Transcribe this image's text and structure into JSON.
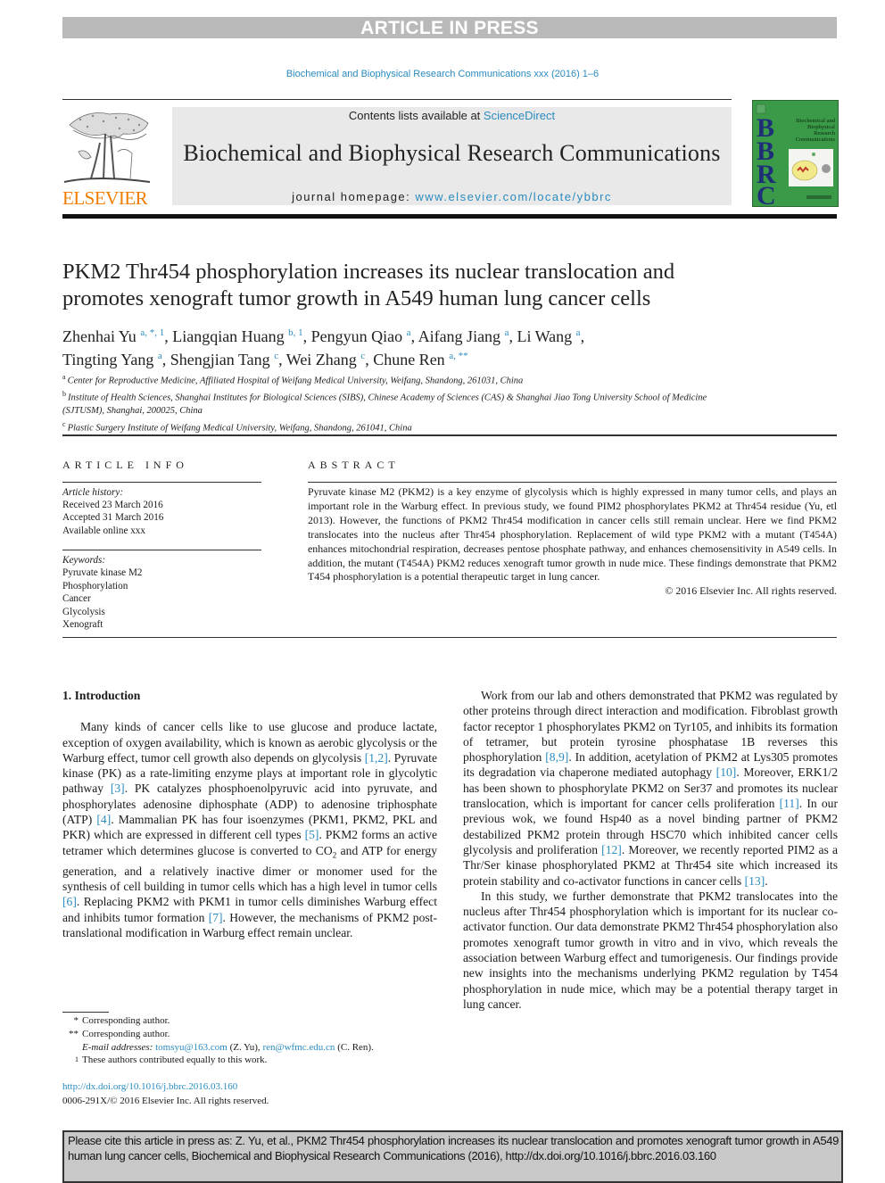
{
  "banner": "ARTICLE IN PRESS",
  "journal_ref": "Biochemical and Biophysical Research Communications xxx (2016) 1–6",
  "header": {
    "contents_prefix": "Contents lists available at ",
    "contents_link": "ScienceDirect",
    "journal_title": "Biochemical and Biophysical Research Communications",
    "homepage_prefix": "journal homepage: ",
    "homepage_link": "www.elsevier.com/locate/ybbrc",
    "publisher_logo": "ELSEVIER",
    "cover": {
      "letters": [
        "B",
        "B",
        "R",
        "C"
      ],
      "title_lines": [
        "Biochemical and",
        "Biophysical",
        "Research",
        "Communications"
      ]
    },
    "colors": {
      "link": "#2a8bbf",
      "elsevier_orange": "#f07d00",
      "cover_green": "#3a9a48",
      "cover_letters": "#1e2f78"
    }
  },
  "article": {
    "title_line1": "PKM2 Thr454 phosphorylation increases its nuclear translocation and",
    "title_line2": "promotes xenograft tumor growth in A549 human lung cancer cells",
    "authors": [
      {
        "name": "Zhenhai Yu",
        "sup": "a, *, 1",
        "sep": ", "
      },
      {
        "name": "Liangqian Huang",
        "sup": "b, 1",
        "sep": ", "
      },
      {
        "name": "Pengyun Qiao",
        "sup": "a",
        "sep": ", "
      },
      {
        "name": "Aifang Jiang",
        "sup": "a",
        "sep": ", "
      },
      {
        "name": "Li Wang",
        "sup": "a",
        "sep": ","
      },
      {
        "name": "Tingting Yang",
        "sup": "a",
        "sep": ", "
      },
      {
        "name": "Shengjian Tang",
        "sup": "c",
        "sep": ", "
      },
      {
        "name": "Wei Zhang",
        "sup": "c",
        "sep": ", "
      },
      {
        "name": "Chune Ren",
        "sup": "a, **",
        "sep": ""
      }
    ],
    "affiliations": [
      {
        "label": "a",
        "text": "Center for Reproductive Medicine, Affiliated Hospital of Weifang Medical University, Weifang, Shandong, 261031, China"
      },
      {
        "label": "b",
        "text": "Institute of Health Sciences, Shanghai Institutes for Biological Sciences (SIBS), Chinese Academy of Sciences (CAS) & Shanghai Jiao Tong University School of Medicine (SJTUSM), Shanghai, 200025, China"
      },
      {
        "label": "c",
        "text": "Plastic Surgery Institute of Weifang Medical University, Weifang, Shandong, 261041, China"
      }
    ]
  },
  "article_info": {
    "heading": "ARTICLE INFO",
    "history_label": "Article history:",
    "history": [
      "Received 23 March 2016",
      "Accepted 31 March 2016",
      "Available online xxx"
    ],
    "keywords_label": "Keywords:",
    "keywords": [
      "Pyruvate kinase M2",
      "Phosphorylation",
      "Cancer",
      "Glycolysis",
      "Xenograft"
    ]
  },
  "abstract": {
    "heading": "ABSTRACT",
    "text": "Pyruvate kinase M2 (PKM2) is a key enzyme of glycolysis which is highly expressed in many tumor cells, and plays an important role in the Warburg effect. In previous study, we found PIM2 phosphorylates PKM2 at Thr454 residue (Yu, etl 2013). However, the functions of PKM2 Thr454 modification in cancer cells still remain unclear. Here we find PKM2 translocates into the nucleus after Thr454 phosphorylation. Replacement of wild type PKM2 with a mutant (T454A) enhances mitochondrial respiration, decreases pentose phosphate pathway, and enhances chemosensitivity in A549 cells. In addition, the mutant (T454A) PKM2 reduces xenograft tumor growth in nude mice. These findings demonstrate that PKM2 T454 phosphorylation is a potential therapeutic target in lung cancer.",
    "copyright": "© 2016 Elsevier Inc. All rights reserved."
  },
  "body": {
    "section_heading": "1.  Introduction",
    "left_paragraphs": [
      [
        {
          "t": "Many kinds of cancer cells like to use glucose and produce lactate, exception of oxygen availability, which is known as aerobic glycolysis or the Warburg effect, tumor cell growth also depends on glycolysis "
        },
        {
          "r": "[1,2]"
        },
        {
          "t": ". Pyruvate kinase (PK) as a rate-limiting enzyme plays at important role in glycolytic pathway "
        },
        {
          "r": "[3]"
        },
        {
          "t": ". PK catalyzes phosphoenolpyruvic acid into pyruvate, and phosphorylates adenosine diphosphate (ADP) to adenosine triphosphate (ATP) "
        },
        {
          "r": "[4]"
        },
        {
          "t": ". Mammalian PK has four isoenzymes (PKM1, PKM2, PKL and PKR) which are expressed in different cell types "
        },
        {
          "r": "[5]"
        },
        {
          "t": ". PKM2 forms an active tetramer which determines glucose is converted to CO"
        },
        {
          "sub": "2"
        },
        {
          "t": " and ATP for energy generation, and a relatively inactive dimer or monomer used for the synthesis of cell building in tumor cells which has a high level in tumor cells "
        },
        {
          "r": "[6]"
        },
        {
          "t": ". Replacing PKM2 with PKM1 in tumor cells diminishes Warburg effect and inhibits tumor formation "
        },
        {
          "r": "[7]"
        },
        {
          "t": ". However, the mechanisms of PKM2 post-translational modification in Warburg effect remain unclear."
        }
      ]
    ],
    "right_paragraphs": [
      [
        {
          "t": "Work from our lab and others demonstrated that PKM2 was regulated by other proteins through direct interaction and modification. Fibroblast growth factor receptor 1 phosphorylates PKM2 on Tyr105, and inhibits its formation of tetramer, but protein tyrosine phosphatase 1B reverses this phosphorylation "
        },
        {
          "r": "[8,9]"
        },
        {
          "t": ". In addition, acetylation of PKM2 at Lys305 promotes its degradation via chaperone mediated autophagy "
        },
        {
          "r": "[10]"
        },
        {
          "t": ". Moreover, ERK1/2 has been shown to phosphorylate PKM2 on Ser37 and promotes its nuclear translocation, which is important for cancer cells proliferation "
        },
        {
          "r": "[11]"
        },
        {
          "t": ". In our previous wok, we found Hsp40 as a novel binding partner of PKM2 destabilized PKM2 protein through HSC70 which inhibited cancer cells glycolysis and proliferation "
        },
        {
          "r": "[12]"
        },
        {
          "t": ". Moreover, we recently reported PIM2 as a Thr/Ser kinase phosphorylated PKM2 at Thr454 site which increased its protein stability and co-activator functions in cancer cells "
        },
        {
          "r": "[13]"
        },
        {
          "t": "."
        }
      ],
      [
        {
          "t": "In this study, we further demonstrate that PKM2 translocates into the nucleus after Thr454 phosphorylation which is important for its nuclear co-activator function. Our data demonstrate PKM2 Thr454 phosphorylation also promotes xenograft tumor growth in vitro and in vivo, which reveals the association between Warburg effect and tumorigenesis. Our findings provide new insights into the mechanisms underlying PKM2 regulation by T454 phosphorylation in nude mice, which may be a potential therapy target in lung cancer."
        }
      ]
    ]
  },
  "footnotes": {
    "corr1_mark": "*",
    "corr1_text": "Corresponding author.",
    "corr2_mark": "**",
    "corr2_text": "Corresponding author.",
    "email_label": "E-mail addresses:",
    "email1": "tomsyu@163.com",
    "email1_owner": " (Z. Yu), ",
    "email2": "ren@wfmc.edu.cn",
    "email2_owner": " (C. Ren).",
    "equal_mark": "1",
    "equal_text": "These authors contributed equally to this work."
  },
  "doi": {
    "link": "http://dx.doi.org/10.1016/j.bbrc.2016.03.160",
    "issn_line": "0006-291X/© 2016 Elsevier Inc. All rights reserved."
  },
  "citation_box": "Please cite this article in press as: Z. Yu, et al., PKM2 Thr454 phosphorylation increases its nuclear translocation and promotes xenograft tumor growth in A549 human lung cancer cells, Biochemical and Biophysical Research Communications (2016), http://dx.doi.org/10.1016/j.bbrc.2016.03.160"
}
